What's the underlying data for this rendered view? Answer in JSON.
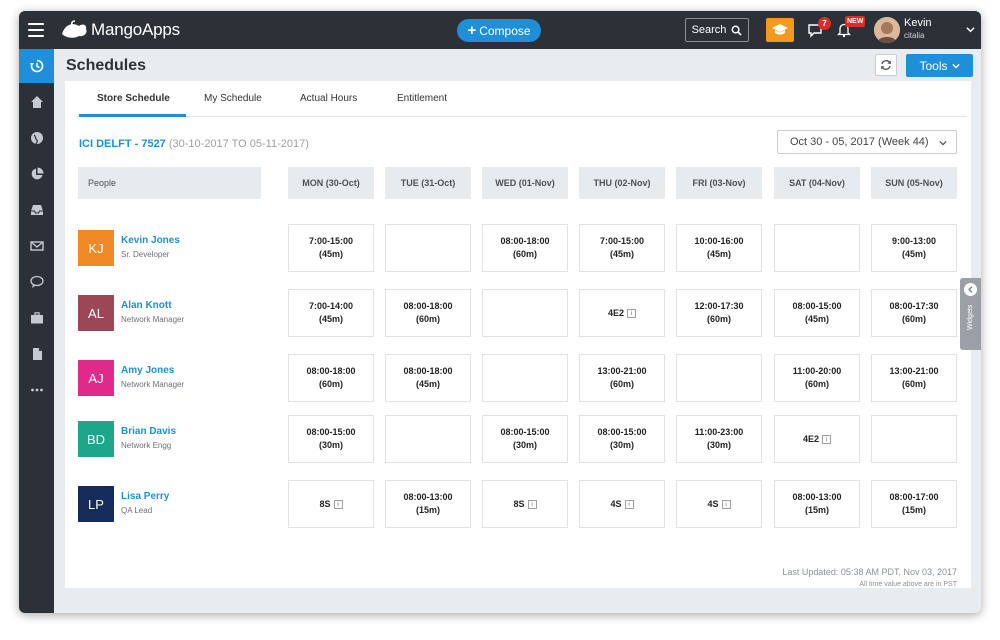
{
  "topbar": {
    "logo_text": "MangoApps",
    "compose_label": "Compose",
    "search_label": "Search",
    "chat_badge": "7",
    "notif_badge": "NEW",
    "user_name": "Kevin",
    "user_sub": "citalia"
  },
  "page": {
    "title": "Schedules",
    "tools_label": "Tools"
  },
  "tabs": [
    {
      "label": "Store Schedule",
      "active": true
    },
    {
      "label": "My Schedule",
      "active": false
    },
    {
      "label": "Actual Hours",
      "active": false
    },
    {
      "label": "Entitlement",
      "active": false
    }
  ],
  "store": {
    "name": "ICI DELFT - 7527",
    "range": "(30-10-2017 TO 05-11-2017)",
    "week": "Oct 30 - 05, 2017 (Week 44)"
  },
  "columns": {
    "people": "People",
    "days": [
      "MON (30-Oct)",
      "TUE (31-Oct)",
      "WED (01-Nov)",
      "THU (02-Nov)",
      "FRI (03-Nov)",
      "SAT (04-Nov)",
      "SUN (05-Nov)"
    ]
  },
  "people": [
    {
      "initials": "KJ",
      "name": "Kevin Jones",
      "role": "Sr. Developer",
      "color": "#f08a24",
      "shifts": [
        [
          "7:00-15:00",
          "(45m)"
        ],
        [],
        [
          "08:00-18:00",
          "(60m)"
        ],
        [
          "7:00-15:00",
          "(45m)"
        ],
        [
          "10:00-16:00",
          "(45m)"
        ],
        [],
        [
          "9:00-13:00",
          "(45m)"
        ]
      ]
    },
    {
      "initials": "AL",
      "name": "Alan Knott",
      "role": "Network Manager",
      "color": "#9b4756",
      "shifts": [
        [
          "7:00-14:00",
          "(45m)"
        ],
        [
          "08:00-18:00",
          "(60m)"
        ],
        [],
        [
          "4E2"
        ],
        [
          "12:00-17:30",
          "(60m)"
        ],
        [
          "08:00-15:00",
          "(45m)"
        ],
        [
          "08:00-17:30",
          "(60m)"
        ]
      ]
    },
    {
      "initials": "AJ",
      "name": "Amy Jones",
      "role": "Network Manager",
      "color": "#e02a8a",
      "shifts": [
        [
          "08:00-18:00",
          "(60m)"
        ],
        [
          "08:00-18:00",
          "(45m)"
        ],
        [],
        [
          "13:00-21:00",
          "(60m)"
        ],
        [],
        [
          "11:00-20:00",
          "(60m)"
        ],
        [
          "13:00-21:00",
          "(60m)"
        ]
      ]
    },
    {
      "initials": "BD",
      "name": "Brian Davis",
      "role": "Network Engg",
      "color": "#1ea68a",
      "shifts": [
        [
          "08:00-15:00",
          "(30m)"
        ],
        [],
        [
          "08:00-15:00",
          "(30m)"
        ],
        [
          "08:00-15:00",
          "(30m)"
        ],
        [
          "11:00-23:00",
          "(30m)"
        ],
        [
          "4E2"
        ],
        []
      ]
    },
    {
      "initials": "LP",
      "name": "Lisa Perry",
      "role": "QA Lead",
      "color": "#152b5c",
      "shifts": [
        [
          "8S"
        ],
        [
          "08:00-13:00",
          "(15m)"
        ],
        [
          "8S"
        ],
        [
          "4S"
        ],
        [
          "4S"
        ],
        [
          "08:00-13:00",
          "(15m)"
        ],
        [
          "08:00-17:00",
          "(15m)"
        ]
      ]
    }
  ],
  "footer": {
    "updated": "Last Updated: 05:38 AM PDT, Nov 03, 2017",
    "note": "All time value above are in PST"
  },
  "widgets_label": "Widgets"
}
